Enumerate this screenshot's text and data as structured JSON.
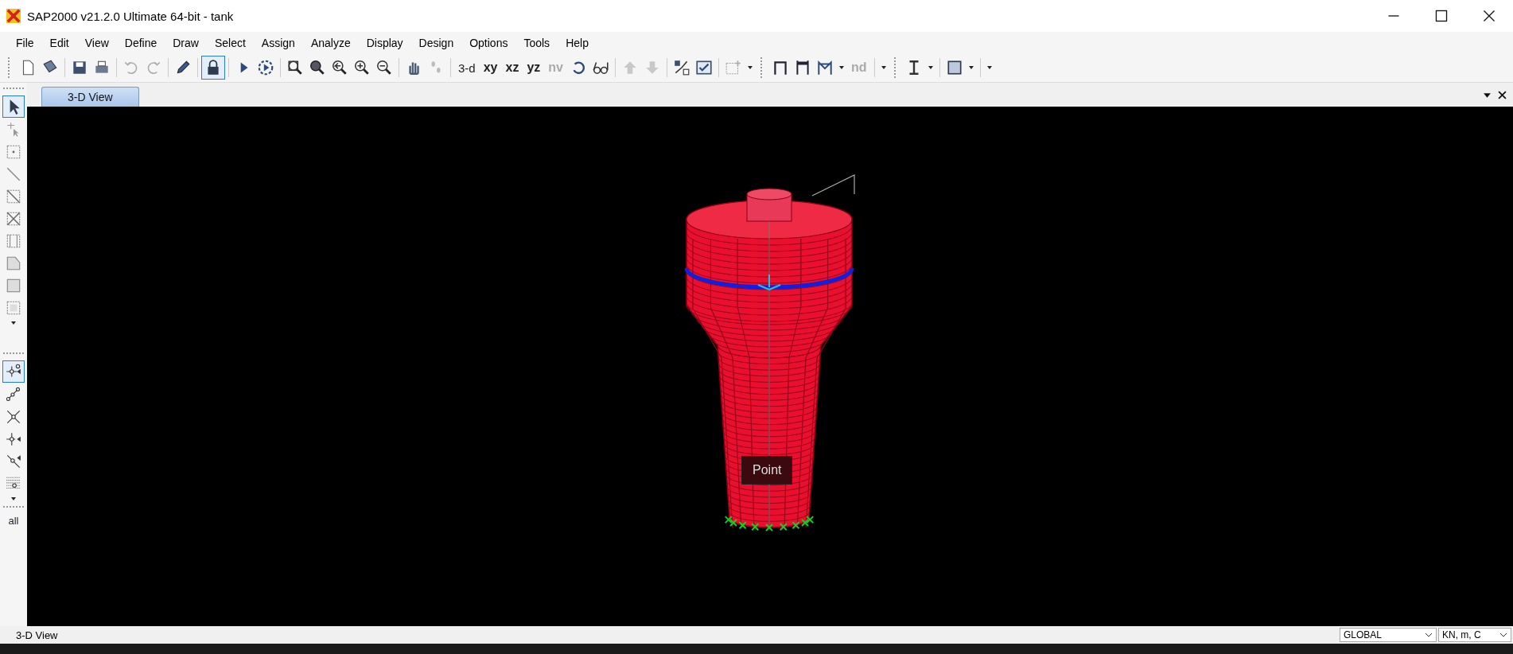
{
  "window": {
    "title": "SAP2000 v21.2.0 Ultimate 64-bit - tank"
  },
  "menu": [
    "File",
    "Edit",
    "View",
    "Define",
    "Draw",
    "Select",
    "Assign",
    "Analyze",
    "Display",
    "Design",
    "Options",
    "Tools",
    "Help"
  ],
  "toolbar": {
    "lock": {
      "on": true
    },
    "view_buttons": [
      {
        "label": "3-d",
        "disabled": false
      },
      {
        "label": "xy",
        "disabled": false
      },
      {
        "label": "xz",
        "disabled": false
      },
      {
        "label": "yz",
        "disabled": false
      },
      {
        "label": "nv",
        "disabled": true
      },
      {
        "label": "nd",
        "disabled": true
      }
    ]
  },
  "left_toolbar": {
    "pointer_selected": true,
    "snap_selected": true,
    "all_label": "all"
  },
  "tabs": [
    {
      "label": "3-D View",
      "selected": true
    }
  ],
  "viewport": {
    "tooltip": "Point"
  },
  "status_bar": {
    "view": "3-D View",
    "coordinate_system": "GLOBAL",
    "units": "KN, m, C"
  }
}
